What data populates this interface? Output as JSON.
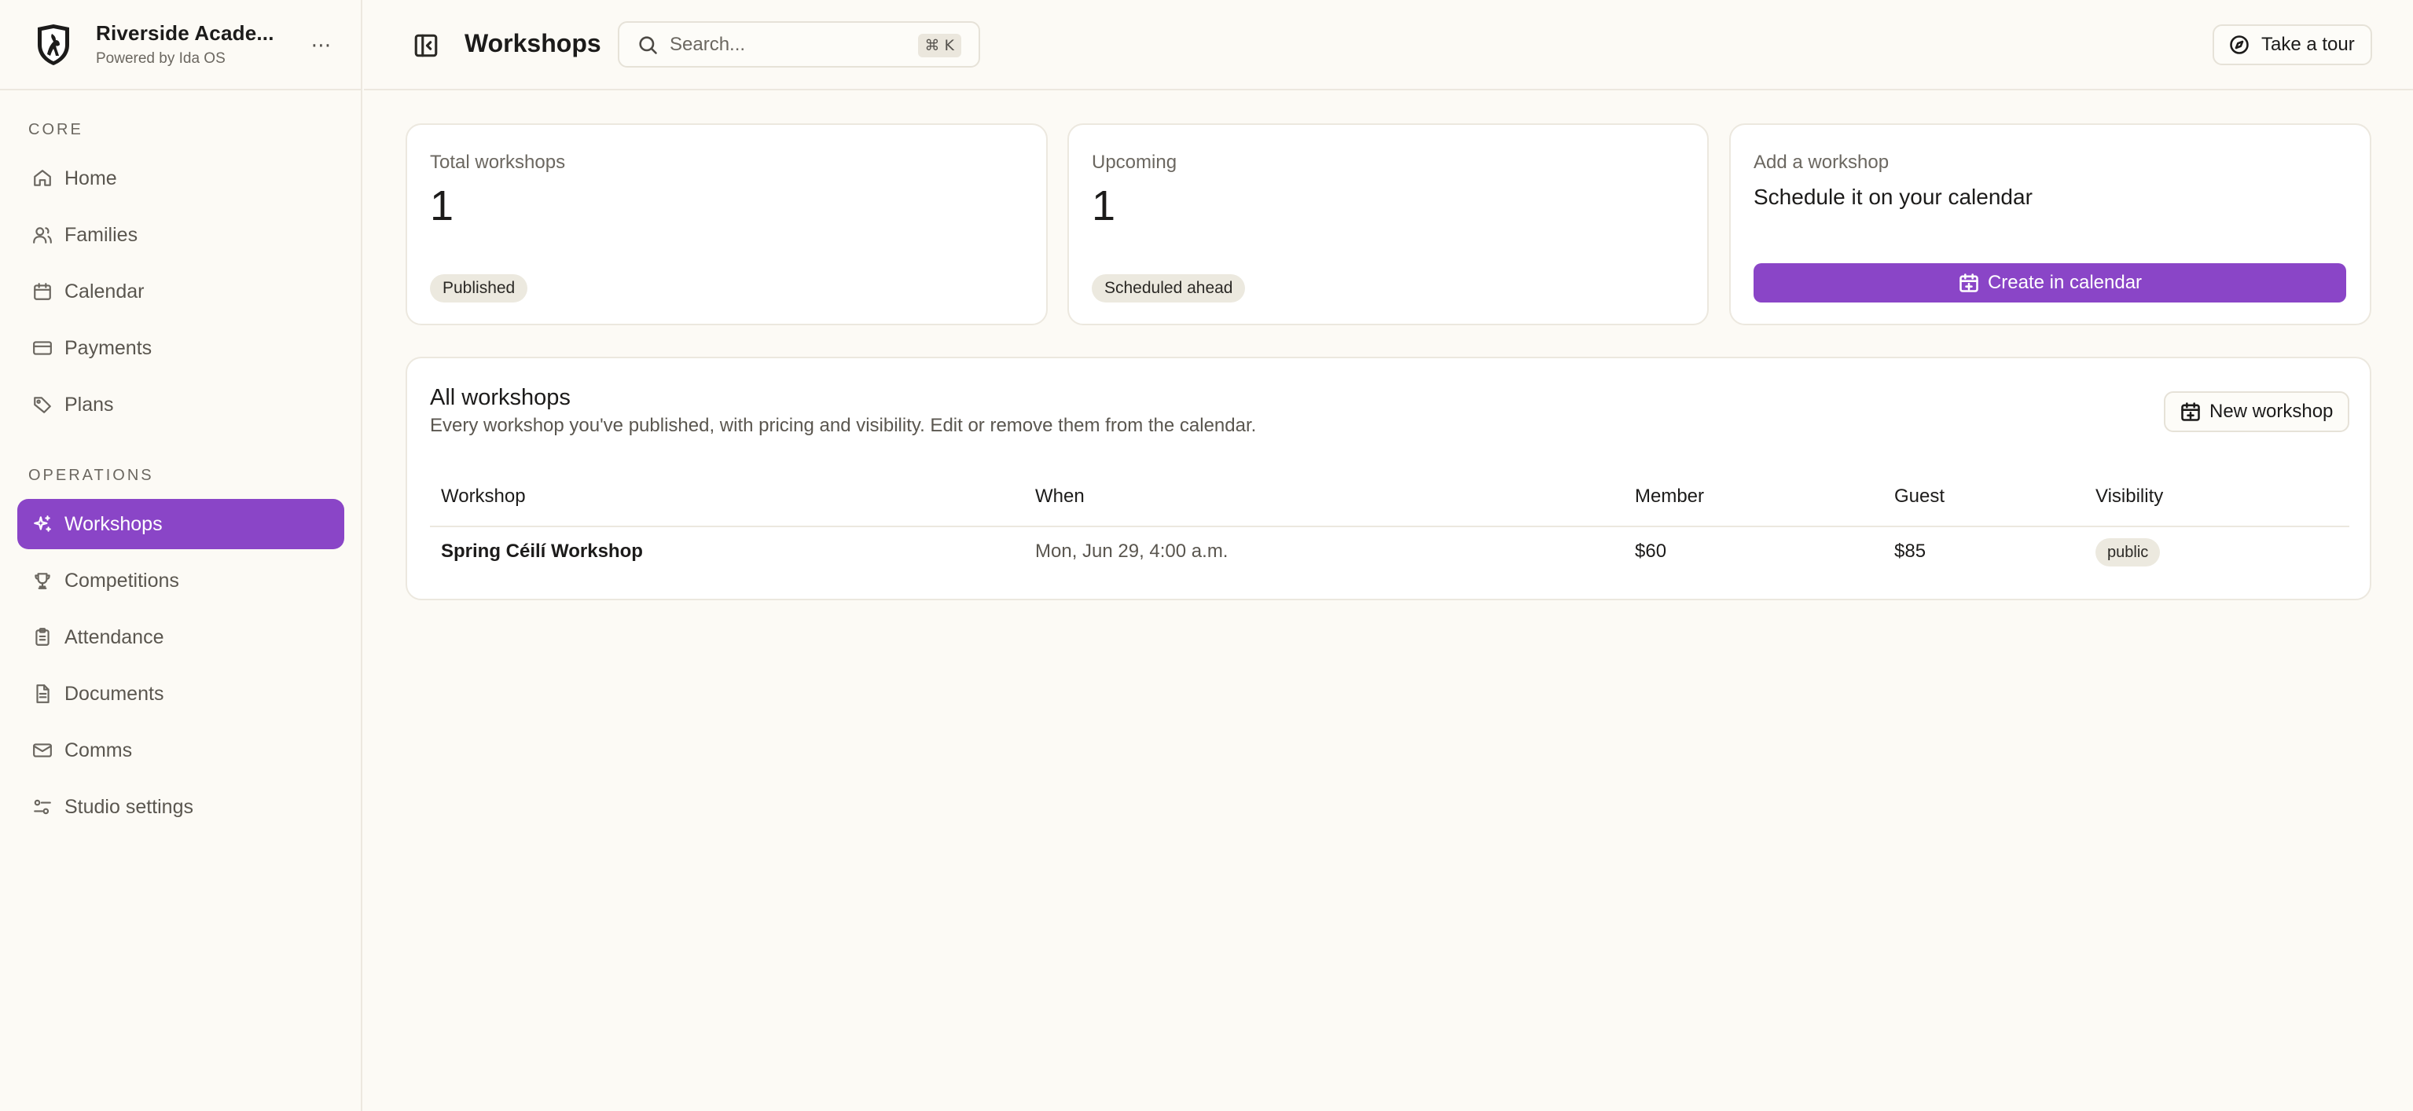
{
  "brand": {
    "name": "Riverside Acade...",
    "subtitle": "Powered by Ida OS",
    "more_label": "⋯"
  },
  "sidebar": {
    "sections": [
      {
        "title": "CORE"
      },
      {
        "title": "OPERATIONS"
      }
    ],
    "items": [
      {
        "label": "Home",
        "icon": "home-icon"
      },
      {
        "label": "Families",
        "icon": "users-icon"
      },
      {
        "label": "Calendar",
        "icon": "calendar-icon"
      },
      {
        "label": "Payments",
        "icon": "credit-card-icon"
      },
      {
        "label": "Plans",
        "icon": "tag-icon"
      },
      {
        "label": "Workshops",
        "icon": "sparkles-icon",
        "active": true
      },
      {
        "label": "Competitions",
        "icon": "trophy-icon"
      },
      {
        "label": "Attendance",
        "icon": "clipboard-icon"
      },
      {
        "label": "Documents",
        "icon": "document-icon"
      },
      {
        "label": "Comms",
        "icon": "mail-icon"
      },
      {
        "label": "Studio settings",
        "icon": "settings-sliders-icon"
      }
    ]
  },
  "header": {
    "title": "Workshops",
    "search_placeholder": "Search...",
    "search_shortcut": "⌘ K",
    "tour_label": "Take a tour"
  },
  "stats": {
    "total": {
      "label": "Total workshops",
      "value": "1",
      "badge": "Published"
    },
    "upcoming": {
      "label": "Upcoming",
      "value": "1",
      "badge": "Scheduled ahead"
    },
    "add": {
      "label": "Add a workshop",
      "heading": "Schedule it on your calendar",
      "button": "Create in calendar"
    }
  },
  "table": {
    "title": "All workshops",
    "subtitle": "Every workshop you've published, with pricing and visibility. Edit or remove them from the calendar.",
    "new_button": "New workshop",
    "columns": [
      "Workshop",
      "When",
      "Member",
      "Guest",
      "Visibility"
    ],
    "rows": [
      {
        "workshop": "Spring Céilí Workshop",
        "when": "Mon, Jun 29, 4:00 a.m.",
        "member": "$60",
        "guest": "$85",
        "visibility": "public"
      }
    ]
  },
  "colors": {
    "accent": "#8a45c7",
    "background": "#fcfaf5"
  }
}
